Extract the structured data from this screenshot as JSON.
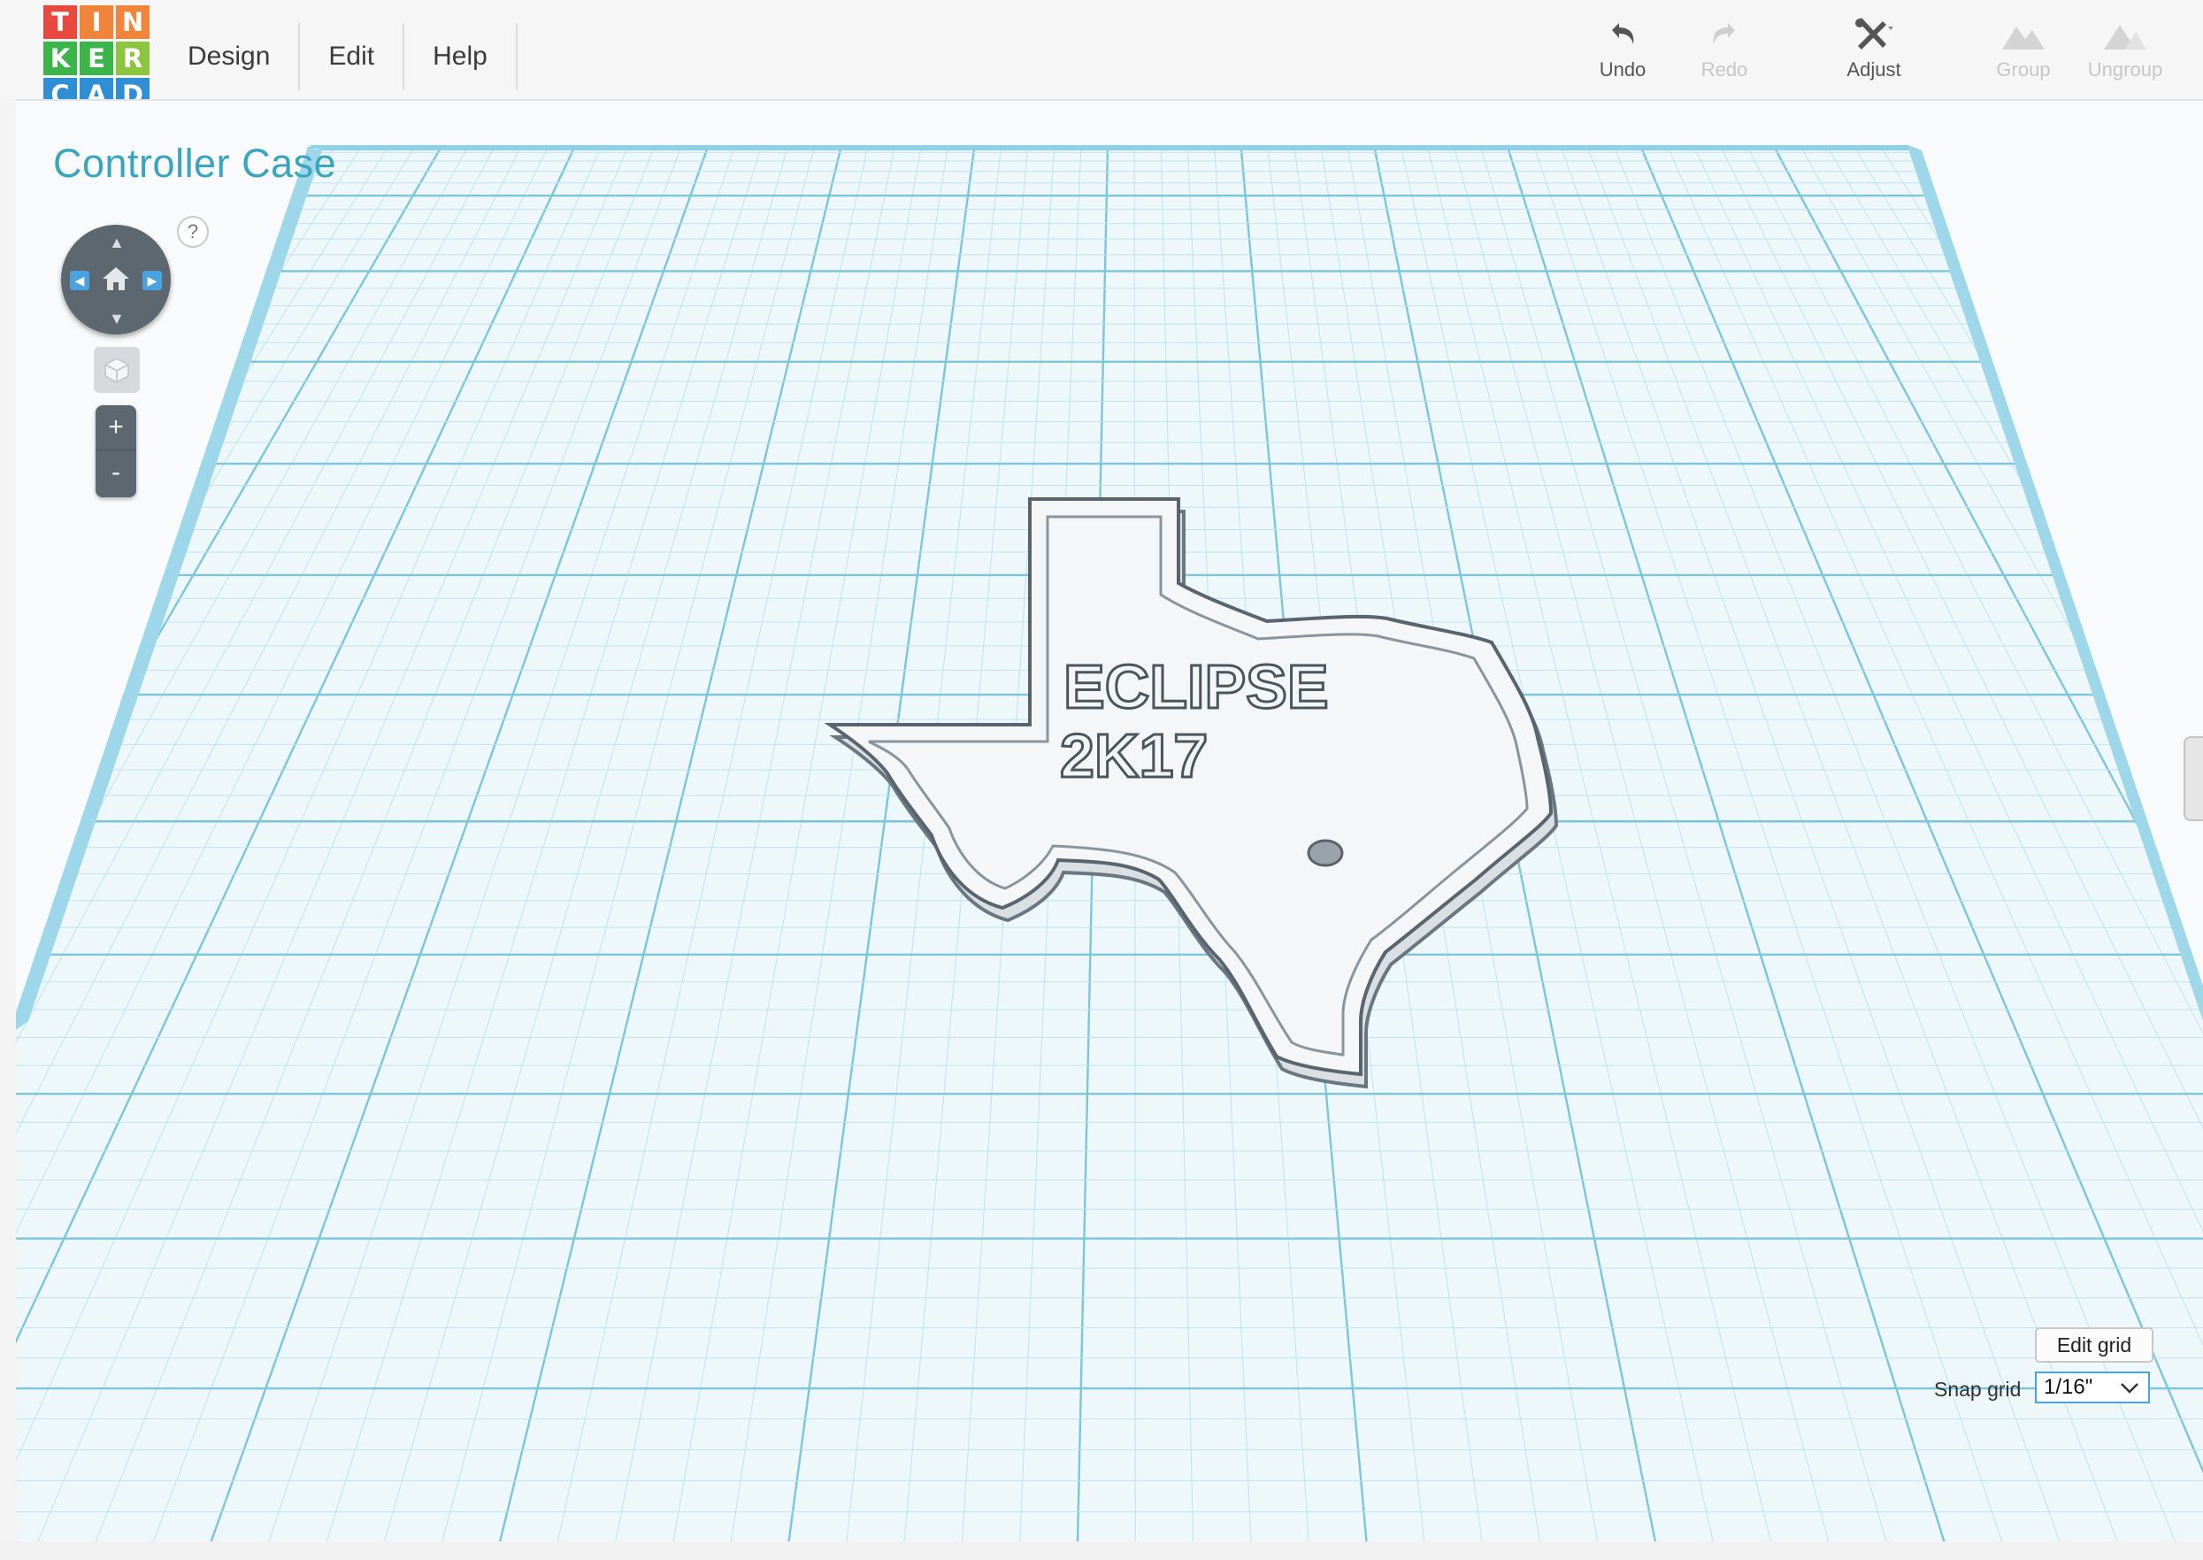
{
  "logo": {
    "letters": [
      "T",
      "I",
      "N",
      "K",
      "E",
      "R",
      "C",
      "A",
      "D"
    ],
    "colors": [
      "#e8483d",
      "#f0843a",
      "#f0843a",
      "#3bb54a",
      "#3bb54a",
      "#8cc63f",
      "#2f8fd6",
      "#2f8fd6",
      "#2f8fd6"
    ]
  },
  "menu": {
    "items": [
      "Design",
      "Edit",
      "Help"
    ]
  },
  "toolbar": {
    "undo": "Undo",
    "redo": "Redo",
    "adjust": "Adjust",
    "group": "Group",
    "ungroup": "Ungroup"
  },
  "document": {
    "title": "Controller Case"
  },
  "view_controls": {
    "help": "?",
    "zoom_in": "+",
    "zoom_out": "-"
  },
  "model": {
    "text_line1": "ECLIPSE",
    "text_line2": "2K17"
  },
  "grid": {
    "edit_label": "Edit grid",
    "snap_label": "Snap grid",
    "snap_value": "1/16\""
  },
  "colors": {
    "accent": "#3aa5bd",
    "grid_major": "#7cc6da",
    "grid_minor": "#bfe3ee",
    "plane_edge": "#8fd0e6",
    "nav_gray": "#5d6770"
  },
  "icons": [
    "undo-icon",
    "redo-icon",
    "adjust-icon",
    "group-icon",
    "ungroup-icon",
    "home-icon",
    "cube-icon",
    "chevron-down-icon"
  ]
}
